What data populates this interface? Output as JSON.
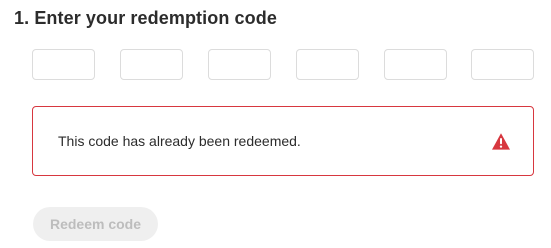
{
  "page": {
    "title": "1. Enter your redemption code"
  },
  "code_inputs": [
    {
      "value": "",
      "placeholder": ""
    },
    {
      "value": "",
      "placeholder": ""
    },
    {
      "value": "",
      "placeholder": ""
    },
    {
      "value": "",
      "placeholder": ""
    },
    {
      "value": "",
      "placeholder": ""
    },
    {
      "value": "",
      "placeholder": ""
    }
  ],
  "error": {
    "message": "This code has already been redeemed.",
    "icon": "alert-triangle-icon",
    "color": "#d7373f"
  },
  "actions": {
    "redeem_label": "Redeem code",
    "redeem_enabled": false
  }
}
